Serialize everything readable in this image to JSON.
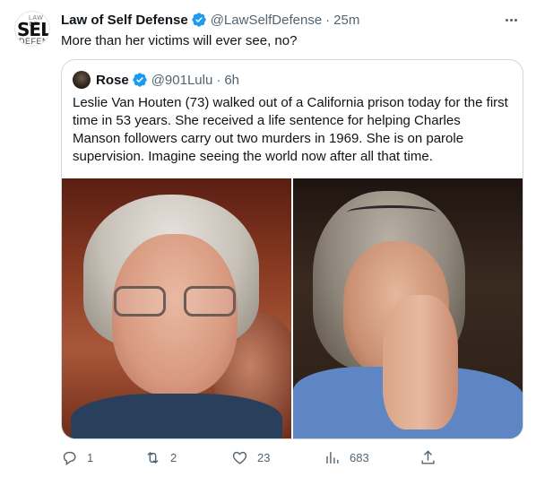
{
  "tweet": {
    "author": {
      "name": "Law of Self Defense",
      "handle": "@LawSelfDefense",
      "time": "25m",
      "avatar_logo": {
        "top": "LAW OF",
        "main": "SELF",
        "bottom": "DEFENSE"
      }
    },
    "text": "More than her victims will ever see, no?",
    "quote": {
      "author": {
        "name": "Rose",
        "handle": "@901Lulu",
        "time": "6h"
      },
      "text": "Leslie Van Houten (73) walked out of a California prison today for the first time in 53 years. She received a life sentence for helping Charles Manson followers carry out two murders in 1969. She is on parole supervision. Imagine seeing the world now after all that time."
    },
    "actions": {
      "replies": "1",
      "retweets": "2",
      "likes": "23",
      "views": "683"
    },
    "colors": {
      "verified": "#1d9bf0",
      "secondary_text": "#536471",
      "border": "#cfd9de"
    },
    "icons": [
      "more-icon",
      "verified-icon",
      "reply-icon",
      "retweet-icon",
      "like-icon",
      "views-icon",
      "share-icon"
    ]
  }
}
